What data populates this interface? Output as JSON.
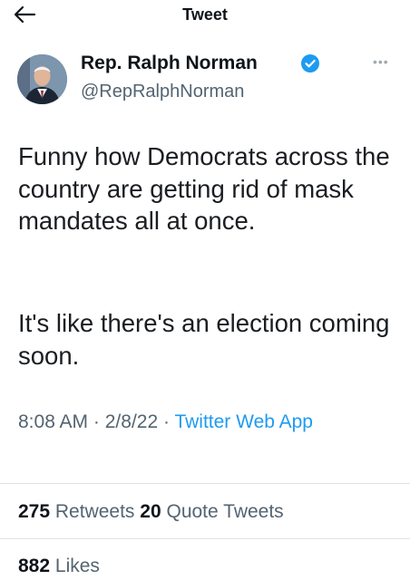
{
  "header": {
    "title": "Tweet"
  },
  "author": {
    "name": "Rep. Ralph Norman",
    "handle": "@RepRalphNorman"
  },
  "tweet": {
    "paragraphs": [
      "Funny how Democrats across the country are getting rid of mask mandates all at once.",
      "It's like there's an election coming soon."
    ],
    "time": "8:08 AM",
    "date": "2/8/22",
    "separator": "·",
    "source": "Twitter Web App"
  },
  "stats": {
    "retweets_count": "275",
    "retweets_label": "Retweets",
    "quotes_count": "20",
    "quotes_label": "Quote Tweets",
    "likes_count": "882",
    "likes_label": "Likes"
  },
  "colors": {
    "accent": "#1d9bf0",
    "secondary_text": "#536471",
    "primary_text": "#0f1419"
  },
  "icons": {
    "back": "arrow-left-icon",
    "verified": "verified-badge-icon",
    "more": "more-icon"
  }
}
